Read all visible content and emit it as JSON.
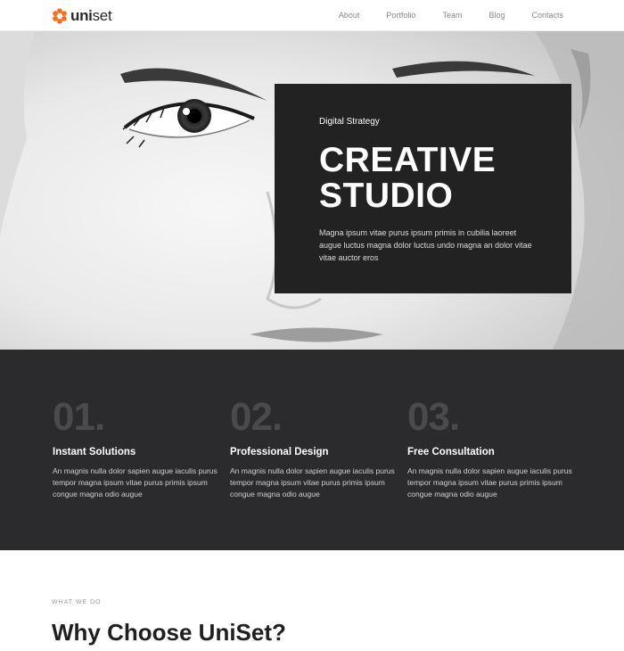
{
  "brand": {
    "name_bold": "uni",
    "name_light": "set",
    "accent": "#f37021"
  },
  "nav": {
    "items": [
      {
        "label": "About"
      },
      {
        "label": "Portfolio"
      },
      {
        "label": "Team"
      },
      {
        "label": "Blog"
      },
      {
        "label": "Contacts"
      }
    ]
  },
  "hero": {
    "eyebrow": "Digital Strategy",
    "title_line1": "CREATIVE",
    "title_line2": "STUDIO",
    "text": "Magna ipsum vitae purus ipsum primis in cubilia laoreet augue luctus magna dolor luctus undo magna an dolor vitae vitae auctor eros"
  },
  "features": [
    {
      "number": "01.",
      "title": "Instant Solutions",
      "text": "An magnis nulla dolor sapien augue iaculis purus tempor magna ipsum vitae purus primis ipsum congue magna odio augue"
    },
    {
      "number": "02.",
      "title": "Professional Design",
      "text": "An magnis nulla dolor sapien augue iaculis purus tempor magna ipsum vitae purus primis ipsum congue magna odio augue"
    },
    {
      "number": "03.",
      "title": "Free Consultation",
      "text": "An magnis nulla dolor sapien augue iaculis purus tempor magna ipsum vitae purus primis ipsum congue magna odio augue"
    }
  ],
  "why": {
    "eyebrow": "WHAT WE DO",
    "title": "Why Choose UniSet?"
  }
}
